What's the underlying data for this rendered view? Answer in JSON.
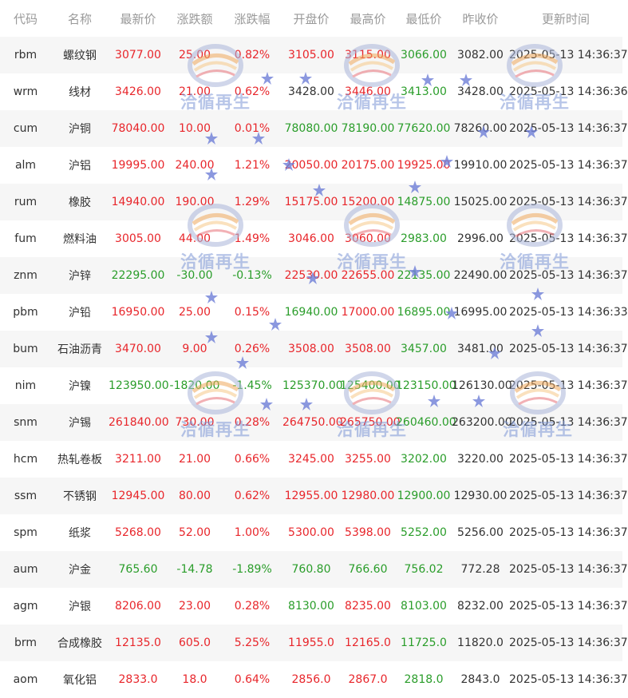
{
  "columns": [
    "代码",
    "名称",
    "最新价",
    "涨跌额",
    "涨跌幅",
    "开盘价",
    "最高价",
    "最低价",
    "昨收价",
    "更新时间"
  ],
  "colors": {
    "up": "#e8262b",
    "down": "#2a9d2a",
    "neutral": "#333333",
    "header": "#9a9a9a",
    "stripe": "#f6f6f6"
  },
  "rows": [
    {
      "code": "rbm",
      "name": "螺纹钢",
      "last": "3077.00",
      "chg": "25.00",
      "pct": "0.82%",
      "open": "3105.00",
      "high": "3115.00",
      "low": "3066.00",
      "prev": "3082.00",
      "time": "2025-05-13 14:36:37",
      "c": [
        "up",
        "up",
        "up",
        "up",
        "up",
        "down",
        "neutral"
      ]
    },
    {
      "code": "wrm",
      "name": "线材",
      "last": "3426.00",
      "chg": "21.00",
      "pct": "0.62%",
      "open": "3428.00",
      "high": "3446.00",
      "low": "3413.00",
      "prev": "3428.00",
      "time": "2025-05-13 14:36:36",
      "c": [
        "up",
        "up",
        "up",
        "neutral",
        "up",
        "down",
        "neutral"
      ]
    },
    {
      "code": "cum",
      "name": "沪铜",
      "last": "78040.00",
      "chg": "10.00",
      "pct": "0.01%",
      "open": "78080.00",
      "high": "78190.00",
      "low": "77620.00",
      "prev": "78260.00",
      "time": "2025-05-13 14:36:37",
      "c": [
        "up",
        "up",
        "up",
        "down",
        "down",
        "down",
        "neutral"
      ]
    },
    {
      "code": "alm",
      "name": "沪铝",
      "last": "19995.00",
      "chg": "240.00",
      "pct": "1.21%",
      "open": "20050.00",
      "high": "20175.00",
      "low": "19925.00",
      "prev": "19910.00",
      "time": "2025-05-13 14:36:37",
      "c": [
        "up",
        "up",
        "up",
        "up",
        "up",
        "up",
        "neutral"
      ]
    },
    {
      "code": "rum",
      "name": "橡胶",
      "last": "14940.00",
      "chg": "190.00",
      "pct": "1.29%",
      "open": "15175.00",
      "high": "15200.00",
      "low": "14875.00",
      "prev": "15025.00",
      "time": "2025-05-13 14:36:37",
      "c": [
        "up",
        "up",
        "up",
        "up",
        "up",
        "down",
        "neutral"
      ]
    },
    {
      "code": "fum",
      "name": "燃料油",
      "last": "3005.00",
      "chg": "44.00",
      "pct": "1.49%",
      "open": "3046.00",
      "high": "3060.00",
      "low": "2983.00",
      "prev": "2996.00",
      "time": "2025-05-13 14:36:37",
      "c": [
        "up",
        "up",
        "up",
        "up",
        "up",
        "down",
        "neutral"
      ]
    },
    {
      "code": "znm",
      "name": "沪锌",
      "last": "22295.00",
      "chg": "-30.00",
      "pct": "-0.13%",
      "open": "22530.00",
      "high": "22655.00",
      "low": "22135.00",
      "prev": "22490.00",
      "time": "2025-05-13 14:36:37",
      "c": [
        "down",
        "down",
        "down",
        "up",
        "up",
        "down",
        "neutral"
      ]
    },
    {
      "code": "pbm",
      "name": "沪铅",
      "last": "16950.00",
      "chg": "25.00",
      "pct": "0.15%",
      "open": "16940.00",
      "high": "17000.00",
      "low": "16895.00",
      "prev": "16995.00",
      "time": "2025-05-13 14:36:33",
      "c": [
        "up",
        "up",
        "up",
        "down",
        "up",
        "down",
        "neutral"
      ]
    },
    {
      "code": "bum",
      "name": "石油沥青",
      "last": "3470.00",
      "chg": "9.00",
      "pct": "0.26%",
      "open": "3508.00",
      "high": "3508.00",
      "low": "3457.00",
      "prev": "3481.00",
      "time": "2025-05-13 14:36:37",
      "c": [
        "up",
        "up",
        "up",
        "up",
        "up",
        "down",
        "neutral"
      ]
    },
    {
      "code": "nim",
      "name": "沪镍",
      "last": "123950.00",
      "chg": "-1820.00",
      "pct": "-1.45%",
      "open": "125370.00",
      "high": "125400.00",
      "low": "123150.00",
      "prev": "126130.00",
      "time": "2025-05-13 14:36:37",
      "c": [
        "down",
        "down",
        "down",
        "down",
        "down",
        "down",
        "neutral"
      ]
    },
    {
      "code": "snm",
      "name": "沪锡",
      "last": "261840.00",
      "chg": "730.00",
      "pct": "0.28%",
      "open": "264750.00",
      "high": "265750.00",
      "low": "260460.00",
      "prev": "263200.00",
      "time": "2025-05-13 14:36:37",
      "c": [
        "up",
        "up",
        "up",
        "up",
        "up",
        "down",
        "neutral"
      ]
    },
    {
      "code": "hcm",
      "name": "热轧卷板",
      "last": "3211.00",
      "chg": "21.00",
      "pct": "0.66%",
      "open": "3245.00",
      "high": "3255.00",
      "low": "3202.00",
      "prev": "3220.00",
      "time": "2025-05-13 14:36:37",
      "c": [
        "up",
        "up",
        "up",
        "up",
        "up",
        "down",
        "neutral"
      ]
    },
    {
      "code": "ssm",
      "name": "不锈钢",
      "last": "12945.00",
      "chg": "80.00",
      "pct": "0.62%",
      "open": "12955.00",
      "high": "12980.00",
      "low": "12900.00",
      "prev": "12930.00",
      "time": "2025-05-13 14:36:37",
      "c": [
        "up",
        "up",
        "up",
        "up",
        "up",
        "down",
        "neutral"
      ]
    },
    {
      "code": "spm",
      "name": "纸浆",
      "last": "5268.00",
      "chg": "52.00",
      "pct": "1.00%",
      "open": "5300.00",
      "high": "5398.00",
      "low": "5252.00",
      "prev": "5256.00",
      "time": "2025-05-13 14:36:37",
      "c": [
        "up",
        "up",
        "up",
        "up",
        "up",
        "down",
        "neutral"
      ]
    },
    {
      "code": "aum",
      "name": "沪金",
      "last": "765.60",
      "chg": "-14.78",
      "pct": "-1.89%",
      "open": "760.80",
      "high": "766.60",
      "low": "756.02",
      "prev": "772.28",
      "time": "2025-05-13 14:36:37",
      "c": [
        "down",
        "down",
        "down",
        "down",
        "down",
        "down",
        "neutral"
      ]
    },
    {
      "code": "agm",
      "name": "沪银",
      "last": "8206.00",
      "chg": "23.00",
      "pct": "0.28%",
      "open": "8130.00",
      "high": "8235.00",
      "low": "8103.00",
      "prev": "8232.00",
      "time": "2025-05-13 14:36:37",
      "c": [
        "up",
        "up",
        "up",
        "down",
        "up",
        "down",
        "neutral"
      ]
    },
    {
      "code": "brm",
      "name": "合成橡胶",
      "last": "12135.0",
      "chg": "605.0",
      "pct": "5.25%",
      "open": "11955.0",
      "high": "12165.0",
      "low": "11725.0",
      "prev": "11820.0",
      "time": "2025-05-13 14:36:37",
      "c": [
        "up",
        "up",
        "up",
        "up",
        "up",
        "down",
        "neutral"
      ]
    },
    {
      "code": "aom",
      "name": "氧化铝",
      "last": "2833.0",
      "chg": "18.0",
      "pct": "0.64%",
      "open": "2856.0",
      "high": "2867.0",
      "low": "2818.0",
      "prev": "2843.0",
      "time": "2025-05-13 14:36:37",
      "c": [
        "up",
        "up",
        "up",
        "up",
        "up",
        "down",
        "neutral"
      ]
    }
  ],
  "watermark": {
    "text": "洽循再生",
    "icon": "recycling-logo-icon",
    "color": "#7d97d6"
  },
  "stars": {
    "icon": "star-icon",
    "color": "#6f7fd8"
  }
}
